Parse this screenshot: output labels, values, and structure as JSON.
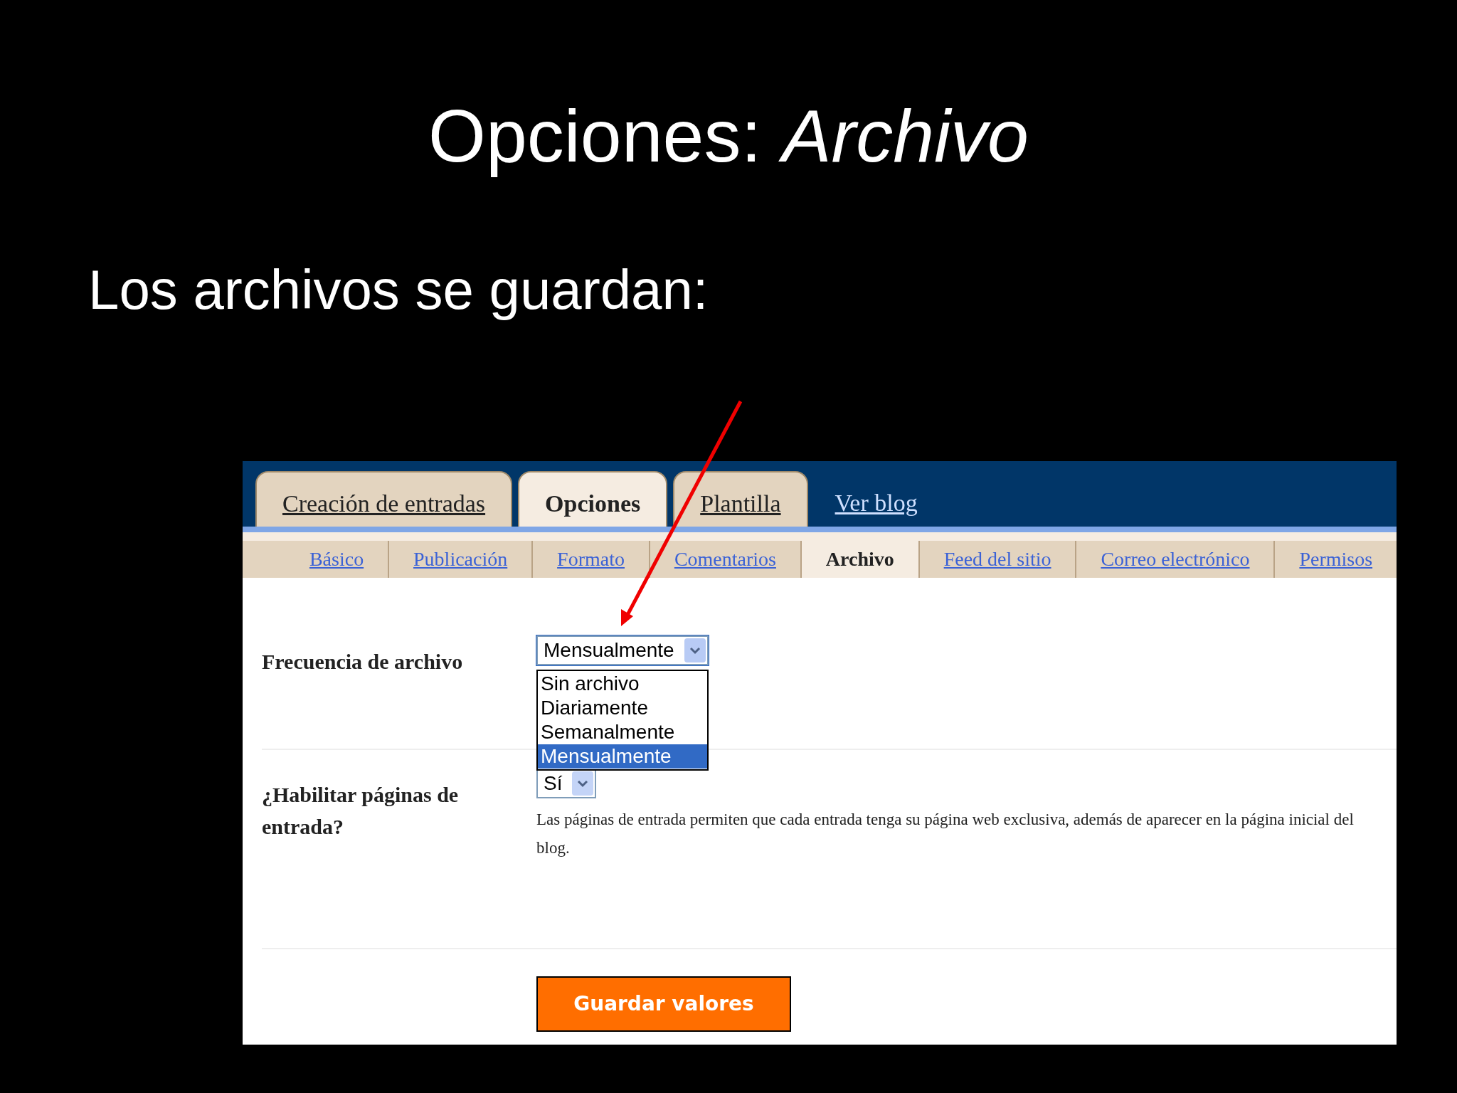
{
  "slide": {
    "title": "Opciones: *Archivo*",
    "subtitle": "Los archivos se guardan:"
  },
  "tabs": [
    {
      "label": "Creación de entradas",
      "kind": "tab",
      "selected": false
    },
    {
      "label": "Opciones",
      "kind": "tab",
      "selected": true
    },
    {
      "label": "Plantilla",
      "kind": "tab",
      "selected": false
    },
    {
      "label": "Ver blog",
      "kind": "link",
      "selected": false
    }
  ],
  "subtabs": [
    {
      "label": "Básico",
      "selected": false
    },
    {
      "label": "Publicación",
      "selected": false
    },
    {
      "label": "Formato",
      "selected": false
    },
    {
      "label": "Comentarios",
      "selected": false
    },
    {
      "label": "Archivo",
      "selected": true
    },
    {
      "label": "Feed del sitio",
      "selected": false
    },
    {
      "label": "Correo electrónico",
      "selected": false
    },
    {
      "label": "Permisos",
      "selected": false
    }
  ],
  "fields": [
    {
      "label": "Frecuencia de archivo",
      "value": "Mensualmente",
      "expanded": true,
      "options": [
        {
          "label": "Sin archivo",
          "selected": false
        },
        {
          "label": "Diariamente",
          "selected": false
        },
        {
          "label": "Semanalmente",
          "selected": false
        },
        {
          "label": "Mensualmente",
          "selected": true
        }
      ]
    },
    {
      "label": "¿Habilitar páginas de entrada?",
      "value": "Sí",
      "expanded": false,
      "description": "Las páginas de entrada permiten que cada entrada tenga su página web exclusiva, además de aparecer en la página inicial del blog."
    }
  ],
  "button": "Guardar valores"
}
